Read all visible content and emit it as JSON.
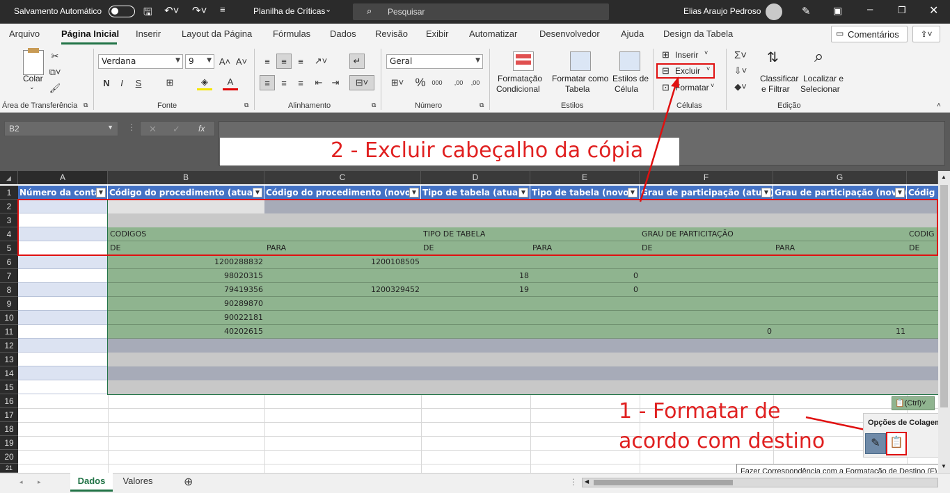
{
  "title_bar": {
    "autosave": "Salvamento Automático",
    "filename": "Planilha de Críticas",
    "search_placeholder": "Pesquisar",
    "user": "Elias Araujo Pedroso"
  },
  "tabs": [
    "Arquivo",
    "Página Inicial",
    "Inserir",
    "Layout da Página",
    "Fórmulas",
    "Dados",
    "Revisão",
    "Exibir",
    "Automatizar",
    "Desenvolvedor",
    "Ajuda",
    "Design da Tabela"
  ],
  "comments_button": "Comentários",
  "ribbon": {
    "clipboard": {
      "paste": "Colar",
      "group": "Área de Transferência"
    },
    "font": {
      "name": "Verdana",
      "size": "9",
      "bold": "N",
      "italic": "I",
      "underline": "S",
      "group": "Fonte"
    },
    "alignment": {
      "group": "Alinhamento"
    },
    "number": {
      "format": "Geral",
      "group": "Número"
    },
    "styles": {
      "cond_line1": "Formatação",
      "cond_line2": "Condicional",
      "table_line1": "Formatar como",
      "table_line2": "Tabela",
      "cell_line1": "Estilos de",
      "cell_line2": "Célula",
      "group": "Estilos"
    },
    "cells": {
      "insert": "Inserir",
      "delete": "Excluir",
      "format": "Formatar",
      "group": "Células"
    },
    "editing": {
      "sort_line1": "Classificar",
      "sort_line2": "e Filtrar",
      "find_line1": "Localizar e",
      "find_line2": "Selecionar",
      "group": "Edição"
    }
  },
  "formula_bar": {
    "name_box": "B2",
    "fx": "fx"
  },
  "annotations": {
    "step2": "2 - Excluir cabeçalho da cópia",
    "step1_line1": "1 - Formatar de",
    "step1_line2": "acordo com destino"
  },
  "columns": [
    "A",
    "B",
    "C",
    "D",
    "E",
    "F",
    "G"
  ],
  "rows": [
    "1",
    "2",
    "3",
    "4",
    "5",
    "6",
    "7",
    "8",
    "9",
    "10",
    "11",
    "12",
    "13",
    "14",
    "15",
    "16",
    "17",
    "18",
    "19",
    "20",
    "21"
  ],
  "headers": [
    "Número da conta",
    "Código do procedimento (atual)",
    "Código do procedimento (novo)",
    "Tipo de tabela (atual)",
    "Tipo de tabela (novo)",
    "Grau de participação (atual)",
    "Grau de participação (novo)",
    "Códig"
  ],
  "cells": {
    "r4_b": "CODIGOS",
    "r4_d": "TIPO DE TABELA",
    "r4_f": "GRAU DE PARTICITAÇÃO",
    "r4_h": "CODIG",
    "r5_b": "DE",
    "r5_c": "PARA",
    "r5_d": "DE",
    "r5_e": "PARA",
    "r5_f": "DE",
    "r5_g": "PARA",
    "r5_h": "DE",
    "r6_b": "1200288832",
    "r6_c": "1200108505",
    "r7_b": "98020315",
    "r7_d": "18",
    "r7_e": "0",
    "r8_b": "79419356",
    "r8_c": "1200329452",
    "r8_d": "19",
    "r8_e": "0",
    "r9_b": "90289870",
    "r10_b": "90022181",
    "r11_b": "40202615",
    "r11_f": "0",
    "r11_g": "11"
  },
  "paste_options": {
    "ctrl": "(Ctrl)",
    "title": "Opções de Colagem:",
    "tooltip": "Fazer Correspondência com a Formatação de Destino (F)"
  },
  "sheets": [
    "Dados",
    "Valores"
  ]
}
